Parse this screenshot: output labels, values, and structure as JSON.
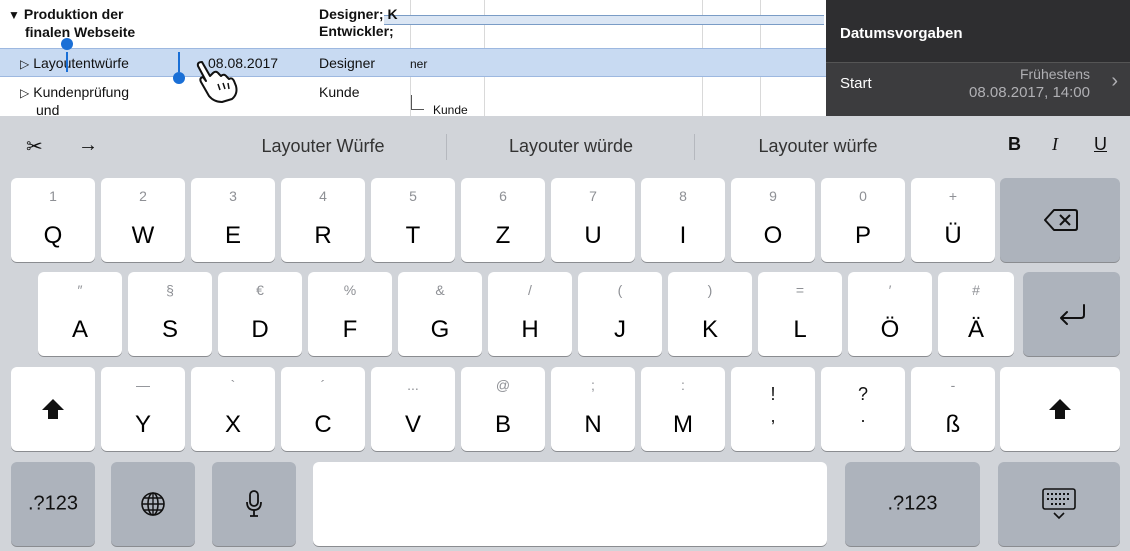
{
  "outline": {
    "rows": [
      {
        "expanded": true,
        "name_line1": "Produktion der",
        "name_line2": "finalen Webseite",
        "resource_line1": "Designer; K",
        "resource_line2": "Entwickler;"
      },
      {
        "expanded": false,
        "name": "Layoutentwürfe",
        "date": "08.08.2017",
        "resource": "Designer",
        "gantt_label": "ner"
      },
      {
        "expanded": false,
        "name_line1": "Kundenprüfung",
        "name_line2": "und",
        "resource": "Kunde",
        "gantt_label": "Kunde"
      }
    ],
    "expanded_marker": "▼",
    "collapsed_marker": "▷"
  },
  "panel": {
    "title": "Datumsvorgaben",
    "start_label": "Start",
    "start_mode": "Frühestens",
    "start_value": "08.08.2017, 14:00",
    "chevron": "›"
  },
  "keyboard": {
    "toolbar": {
      "cut_icon": "scissors-icon",
      "cut_glyph": "✂",
      "tab_glyph": "→",
      "suggestions": [
        "Layouter Würfe",
        "Layouter würde",
        "Layouter würfe"
      ],
      "bold": "B",
      "italic": "I",
      "underline": "U"
    },
    "row1": [
      {
        "main": "Q",
        "sub": "1"
      },
      {
        "main": "W",
        "sub": "2"
      },
      {
        "main": "E",
        "sub": "3"
      },
      {
        "main": "R",
        "sub": "4"
      },
      {
        "main": "T",
        "sub": "5"
      },
      {
        "main": "Z",
        "sub": "6"
      },
      {
        "main": "U",
        "sub": "7"
      },
      {
        "main": "I",
        "sub": "8"
      },
      {
        "main": "O",
        "sub": "9"
      },
      {
        "main": "P",
        "sub": "0"
      },
      {
        "main": "Ü",
        "sub": "+"
      }
    ],
    "row2": [
      {
        "main": "A",
        "sub": "″"
      },
      {
        "main": "S",
        "sub": "§"
      },
      {
        "main": "D",
        "sub": "€"
      },
      {
        "main": "F",
        "sub": "%"
      },
      {
        "main": "G",
        "sub": "&"
      },
      {
        "main": "H",
        "sub": "/"
      },
      {
        "main": "J",
        "sub": "("
      },
      {
        "main": "K",
        "sub": ")"
      },
      {
        "main": "L",
        "sub": "="
      },
      {
        "main": "Ö",
        "sub": "′"
      },
      {
        "main": "Ä",
        "sub": "#"
      }
    ],
    "row3": [
      {
        "main": "Y",
        "sub": "—"
      },
      {
        "main": "X",
        "sub": "`"
      },
      {
        "main": "C",
        "sub": "´"
      },
      {
        "main": "V",
        "sub": "..."
      },
      {
        "main": "B",
        "sub": "@"
      },
      {
        "main": "N",
        "sub": ";"
      },
      {
        "main": "M",
        "sub": ":"
      },
      {
        "top": "!",
        "bottom": ","
      },
      {
        "top": "?",
        "bottom": "."
      },
      {
        "main": "ß",
        "sub": "-"
      }
    ],
    "row4": {
      "numbers_left": ".?123",
      "globe_icon": "globe-icon",
      "mic_icon": "microphone-icon",
      "numbers_right": ".?123",
      "hide_icon": "keyboard-hide-icon"
    },
    "backspace_icon": "backspace-icon",
    "return_icon": "return-icon",
    "shift_icon": "shift-icon"
  }
}
